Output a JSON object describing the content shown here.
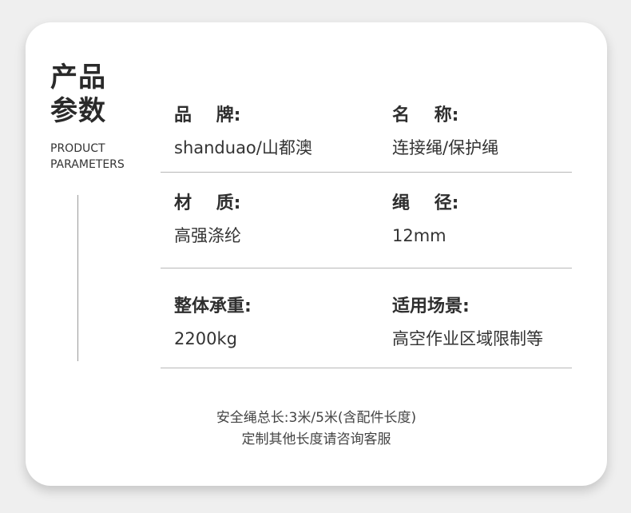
{
  "title": {
    "line1": "产品",
    "line2": "参数",
    "subtitle_line1": "PRODUCT",
    "subtitle_line2": "PARAMETERS"
  },
  "params": [
    {
      "label": "品    牌:",
      "value": "shanduao/山都澳"
    },
    {
      "label": "名    称:",
      "value": "连接绳/保护绳"
    },
    {
      "label": "材    质:",
      "value": "高强涤纶"
    },
    {
      "label": "绳    径:",
      "value": "12mm"
    },
    {
      "label": "整体承重:",
      "value": "2200kg"
    },
    {
      "label": "适用场景:",
      "value": "高空作业区域限制等"
    }
  ],
  "notes": {
    "line1": "安全绳总长:3米/5米(含配件长度)",
    "line2": "定制其他长度请咨询客服"
  },
  "colors": {
    "background": "#efefef",
    "card": "#ffffff",
    "divider": "#b8b8b8",
    "text": "#333333"
  }
}
